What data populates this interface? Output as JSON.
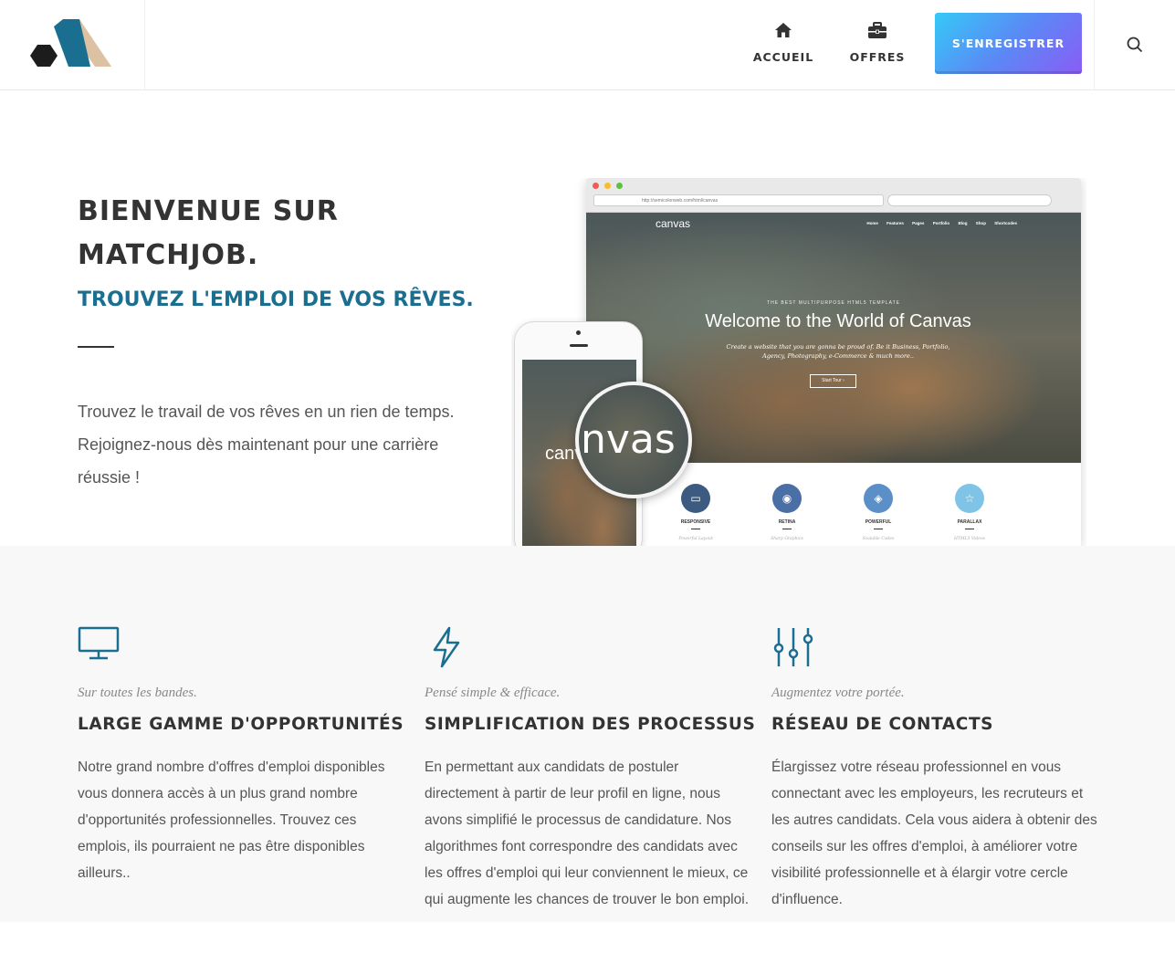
{
  "header": {
    "nav": [
      {
        "label": "ACCUEIL",
        "icon": "home-icon"
      },
      {
        "label": "OFFRES",
        "icon": "briefcase-icon"
      }
    ],
    "register_label": "S'ENREGISTRER",
    "search_icon": "search-icon",
    "logo_colors": [
      "#1c1c1c",
      "#1a6f91",
      "#dcc1a3"
    ]
  },
  "hero": {
    "title": "BIENVENUE SUR MATCHJOB.",
    "subtitle": "TROUVEZ L'EMPLOI DE VOS RÊVES.",
    "text": "Trouvez le travail de vos rêves en un rien de temps. Rejoignez-nous dès maintenant pour une carrière réussie !"
  },
  "mockup": {
    "url": "http://semicolonweb.com/html/canvas",
    "site_logo": "canvas",
    "site_nav": [
      "Home",
      "Features",
      "Pages",
      "Portfolio",
      "Blog",
      "Shop",
      "Shortcodes"
    ],
    "kicker": "THE BEST MULTIPURPOSE HTML5 TEMPLATE",
    "headline": "Welcome to the World of Canvas",
    "description": "Create a website that you are gonna be proud of. Be it Business, Portfolio, Agency, Photography, e-Commerce & much more..",
    "button": "Start Tour ›",
    "features": [
      {
        "name": "RESPONSIVE",
        "desc": "Powerful Layout",
        "color": "#3d5a80"
      },
      {
        "name": "RETINA",
        "desc": "Sharp Graphics",
        "color": "#4a6fa5"
      },
      {
        "name": "POWERFUL",
        "desc": "Scalable Codes",
        "color": "#5b8fc7"
      },
      {
        "name": "PARALLAX",
        "desc": "HTML5 Videos",
        "color": "#7fc4e6"
      }
    ],
    "phone_text": "canvas",
    "magnifier_text": "nvas"
  },
  "features": [
    {
      "icon": "monitor-icon",
      "tagline": "Sur toutes les bandes.",
      "title": "LARGE GAMME D'OPPORTUNITÉS",
      "text": "Notre grand nombre d'offres d'emploi disponibles vous donnera accès à un plus grand nombre d'opportunités professionnelles. Trouvez ces emplois, ils pourraient ne pas être disponibles ailleurs.."
    },
    {
      "icon": "lightning-icon",
      "tagline": "Pensé simple & efficace.",
      "title": "SIMPLIFICATION DES PROCESSUS",
      "text": "En permettant aux candidats de postuler directement à partir de leur profil en ligne, nous avons simplifié le processus de candidature. Nos algorithmes font correspondre des candidats avec les offres d'emploi qui leur conviennent le mieux, ce qui augmente les chances de trouver le bon emploi."
    },
    {
      "icon": "sliders-icon",
      "tagline": "Augmentez votre portée.",
      "title": "RÉSEAU DE CONTACTS",
      "text": "Élargissez votre réseau professionnel en vous connectant avec les employeurs, les recruteurs et les autres candidats. Cela vous aidera à obtenir des conseils sur les offres d'emploi, à améliorer votre visibilité professionnelle et à élargir votre cercle d'influence."
    }
  ],
  "colors": {
    "accent": "#1a6f91",
    "features_bg": "#f8f8f8"
  }
}
